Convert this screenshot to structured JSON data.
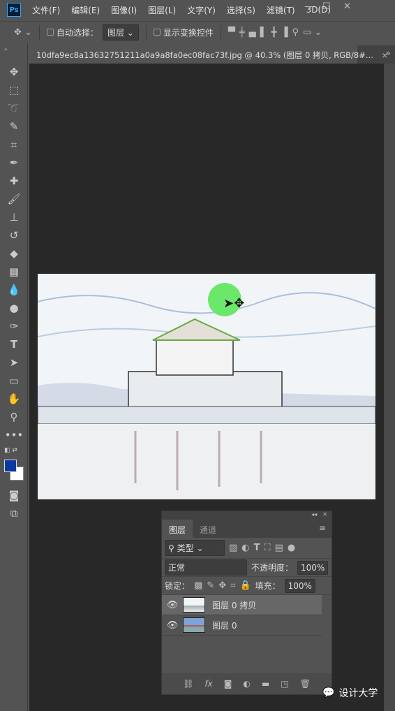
{
  "app": {
    "logo": "Ps"
  },
  "menu": [
    "文件(F)",
    "编辑(E)",
    "图像(I)",
    "图层(L)",
    "文字(Y)",
    "选择(S)",
    "滤镜(T)",
    "3D(D)"
  ],
  "options": {
    "auto_select_label": "自动选择：",
    "auto_select_value": "图层",
    "show_transform_label": "显示变换控件"
  },
  "document": {
    "tab_title": "10dfa9ec8a13632751211a0a9a8fa0ec08fac73f.jpg @ 40.3% (图层 0 拷贝, RGB/8#...",
    "close": "×",
    "overflow": "»"
  },
  "colors": {
    "foreground": "#0a3aa0",
    "background": "#ffffff",
    "cursor_highlight": "#6be86b"
  },
  "layers_panel": {
    "tabs": [
      "图层",
      "通道"
    ],
    "filter_value": "类型",
    "blend_mode": "正常",
    "opacity_label": "不透明度：",
    "opacity_value": "100%",
    "lock_label": "锁定：",
    "fill_label": "填充：",
    "fill_value": "100%",
    "layers": [
      {
        "name": "图层 0 拷贝",
        "selected": true,
        "visible": true
      },
      {
        "name": "图层 0",
        "selected": false,
        "visible": true
      }
    ]
  },
  "watermark": "设计大学"
}
